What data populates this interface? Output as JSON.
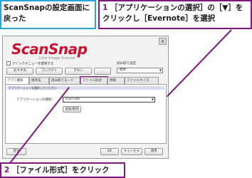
{
  "callouts": {
    "top_left": "ScanSnapの設定画面に戻った",
    "top_right_num": "1",
    "top_right_text": "［アプリケーションの選択］の［▼］をクリックし［Evernote］を選択",
    "bottom_num": "2",
    "bottom_text": "［ファイル形式］をクリック"
  },
  "window": {
    "close": "x",
    "logo": "ScanSnap",
    "logo_sub": "Color Image Scanner",
    "quick_menu": "クイックメニューを使用する",
    "read_settings_label": "読み取り設定",
    "read_settings_value": "標準",
    "top_buttons": [
      "おすすめ",
      "コンパクト",
      "きれい",
      "..."
    ],
    "tabs": [
      "アプリ選択",
      "保存先",
      "読み取りモード",
      "ファイル形式",
      "原稿",
      "ファイルサイズ"
    ],
    "info_bar": "アプリケーションを選択してください",
    "app_label": "アプリケーションの選択：",
    "app_value": "Evernote",
    "add_delete": "追加/削除",
    "hide_details": "隠す",
    "ok": "OK",
    "cancel": "キャンセル",
    "apply": "適用"
  },
  "colors": {
    "accent": "#7e1780",
    "callout_blue": "#29a5dc",
    "logo_red": "#c8102e"
  }
}
